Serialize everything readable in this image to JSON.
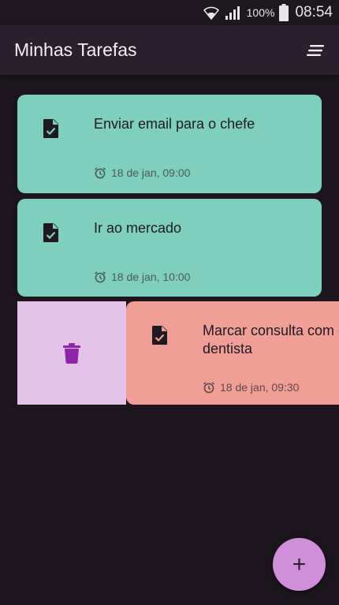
{
  "status_bar": {
    "battery": "100%",
    "time": "08:54",
    "icons": [
      "wifi-icon",
      "signal-icon",
      "battery-icon"
    ]
  },
  "app_bar": {
    "title": "Minhas Tarefas",
    "menu_icon": "sort-icon"
  },
  "tasks": [
    {
      "title": "Enviar email para o chefe",
      "time": "18 de jan, 09:00",
      "color": "#7fcfbf"
    },
    {
      "title": "Ir ao mercado",
      "time": "18 de jan, 10:00",
      "color": "#7fcfbf"
    },
    {
      "title": "Marcar consulta com o dentista",
      "time": "18 de jan, 09:30",
      "color": "#f19e96",
      "swiped": true
    }
  ],
  "swipe_action": {
    "icon": "trash-icon",
    "background": "#e4c2e7",
    "icon_color": "#8e24aa"
  },
  "fab": {
    "label": "+",
    "color": "#cf90d9"
  },
  "theme": {
    "background": "#1c151d",
    "app_bar": "#2a1f2c"
  }
}
